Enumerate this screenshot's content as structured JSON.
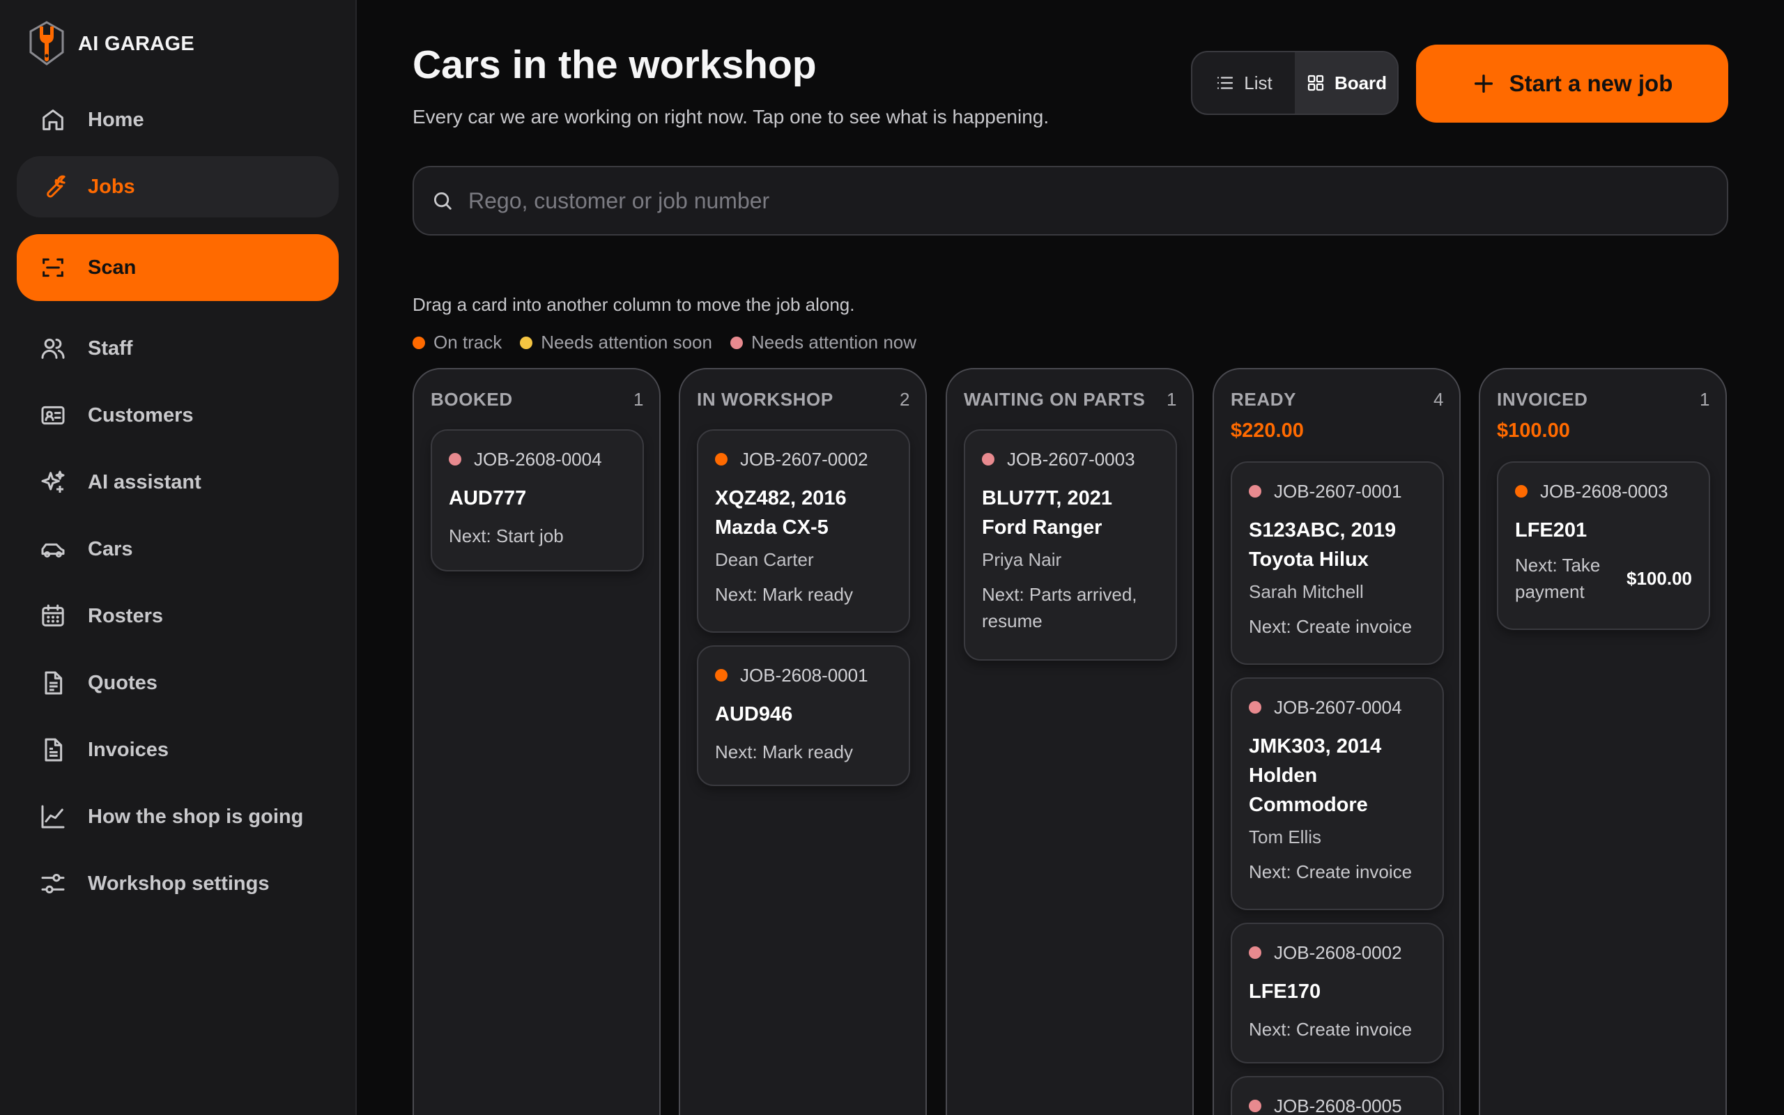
{
  "brand": {
    "name": "AI GARAGE"
  },
  "sidebar": {
    "items": [
      {
        "label": "Home",
        "icon": "home-icon"
      },
      {
        "label": "Jobs",
        "icon": "wrench-icon"
      },
      {
        "label": "Scan",
        "icon": "scan-icon"
      },
      {
        "label": "Staff",
        "icon": "users-icon"
      },
      {
        "label": "Customers",
        "icon": "id-card-icon"
      },
      {
        "label": "AI assistant",
        "icon": "sparkles-icon"
      },
      {
        "label": "Cars",
        "icon": "car-icon"
      },
      {
        "label": "Rosters",
        "icon": "calendar-icon"
      },
      {
        "label": "Quotes",
        "icon": "document-icon"
      },
      {
        "label": "Invoices",
        "icon": "invoice-icon"
      },
      {
        "label": "How the shop is going",
        "icon": "chart-line-icon"
      },
      {
        "label": "Workshop settings",
        "icon": "sliders-icon"
      }
    ]
  },
  "header": {
    "title": "Cars in the workshop",
    "subtitle": "Every car we are working on right now. Tap one to see what is happening.",
    "view_toggle": {
      "list": "List",
      "board": "Board",
      "selected": "Board"
    },
    "new_job": "Start a new job"
  },
  "search": {
    "placeholder": "Rego, customer or job number",
    "value": ""
  },
  "board": {
    "hint": "Drag a card into another column to move the job along.",
    "legend": [
      {
        "label": "On track",
        "color": "#ff6a00"
      },
      {
        "label": "Needs attention soon",
        "color": "#f5c542"
      },
      {
        "label": "Needs attention now",
        "color": "#e88a8f"
      }
    ],
    "columns": [
      {
        "title": "BOOKED",
        "count": "1",
        "total": "",
        "cards": [
          {
            "id": "JOB-2608-0004",
            "status_color": "#e88a8f",
            "title": "AUD777",
            "customer": "",
            "next": "Next: Start job",
            "amount": ""
          }
        ]
      },
      {
        "title": "IN WORKSHOP",
        "count": "2",
        "total": "",
        "cards": [
          {
            "id": "JOB-2607-0002",
            "status_color": "#ff6a00",
            "title": "XQZ482, 2016 Mazda CX-5",
            "customer": "Dean Carter",
            "next": "Next: Mark ready",
            "amount": ""
          },
          {
            "id": "JOB-2608-0001",
            "status_color": "#ff6a00",
            "title": "AUD946",
            "customer": "",
            "next": "Next: Mark ready",
            "amount": ""
          }
        ]
      },
      {
        "title": "WAITING ON PARTS",
        "count": "1",
        "total": "",
        "cards": [
          {
            "id": "JOB-2607-0003",
            "status_color": "#e88a8f",
            "title": "BLU77T, 2021 Ford Ranger",
            "customer": "Priya Nair",
            "next": "Next: Parts arrived, resume",
            "amount": ""
          }
        ]
      },
      {
        "title": "READY",
        "count": "4",
        "total": "$220.00",
        "cards": [
          {
            "id": "JOB-2607-0001",
            "status_color": "#e88a8f",
            "title": "S123ABC, 2019 Toyota Hilux",
            "customer": "Sarah Mitchell",
            "next": "Next: Create invoice",
            "amount": ""
          },
          {
            "id": "JOB-2607-0004",
            "status_color": "#e88a8f",
            "title": "JMK303, 2014 Holden Commodore",
            "customer": "Tom Ellis",
            "next": "Next: Create invoice",
            "amount": ""
          },
          {
            "id": "JOB-2608-0002",
            "status_color": "#e88a8f",
            "title": "LFE170",
            "customer": "",
            "next": "Next: Create invoice",
            "amount": ""
          },
          {
            "id": "JOB-2608-0005",
            "status_color": "#e88a8f",
            "title": "",
            "customer": "",
            "next": "",
            "amount": ""
          }
        ]
      },
      {
        "title": "INVOICED",
        "count": "1",
        "total": "$100.00",
        "cards": [
          {
            "id": "JOB-2608-0003",
            "status_color": "#ff6a00",
            "title": "LFE201",
            "customer": "",
            "next": "Next: Take payment",
            "amount": "$100.00"
          }
        ]
      }
    ]
  },
  "colors": {
    "accent": "#ff6a00",
    "background": "#0b0b0c",
    "sidebar": "#19191b"
  }
}
